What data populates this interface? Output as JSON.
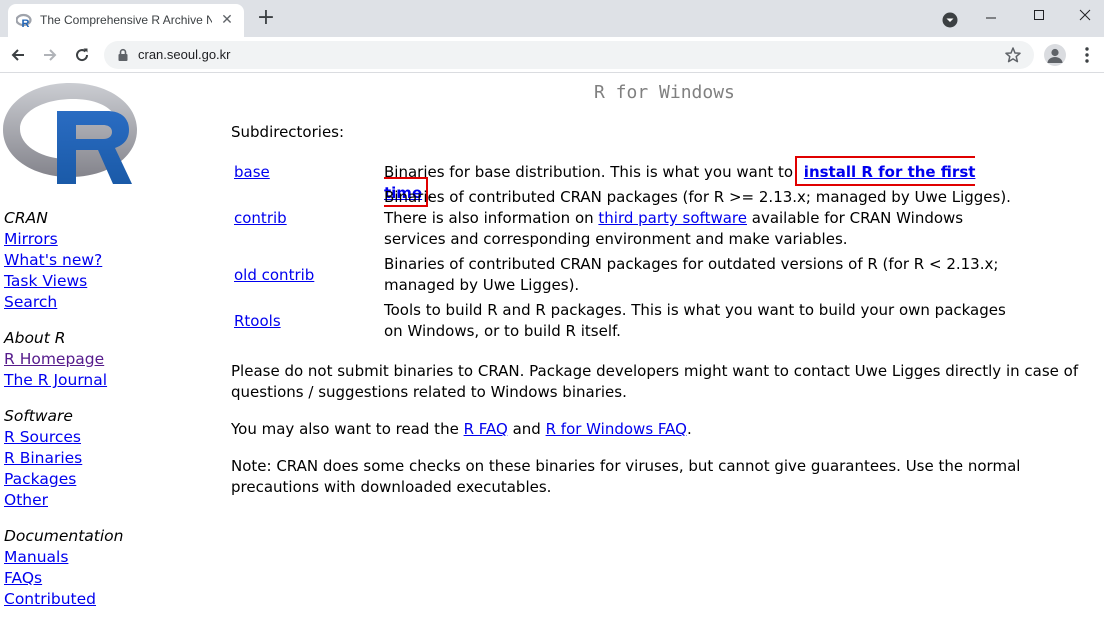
{
  "browser": {
    "tab_title": "The Comprehensive R Archive N",
    "url": "cran.seoul.go.kr",
    "close_glyph": "✕",
    "new_tab_glyph": "+"
  },
  "sidebar": {
    "groups": [
      {
        "heading": "CRAN",
        "links": [
          "Mirrors",
          "What's new?",
          "Task Views",
          "Search"
        ]
      },
      {
        "heading": "About R",
        "links": [
          "R Homepage",
          "The R Journal"
        ]
      },
      {
        "heading": "Software",
        "links": [
          "R Sources",
          "R Binaries",
          "Packages",
          "Other"
        ]
      },
      {
        "heading": "Documentation",
        "links": [
          "Manuals",
          "FAQs",
          "Contributed"
        ]
      }
    ]
  },
  "main": {
    "title": "R for Windows",
    "subdirectories_label": "Subdirectories:",
    "rows": [
      {
        "name": "base",
        "desc_before": "Binaries for base distribution. This is what you want to ",
        "desc_link": "install R for the first time",
        "desc_after": "."
      },
      {
        "name": "contrib",
        "line1": "Binaries of contributed CRAN packages (for R >= 2.13.x; managed by Uwe Ligges).",
        "line2_before": "There is also information on ",
        "line2_link": "third party software",
        "line2_after": " available for CRAN Windows services and corresponding environment and make variables."
      },
      {
        "name": "old contrib",
        "desc": "Binaries of contributed CRAN packages for outdated versions of R (for R < 2.13.x; managed by Uwe Ligges)."
      },
      {
        "name": "Rtools",
        "desc": "Tools to build R and R packages. This is what you want to build your own packages on Windows, or to build R itself."
      }
    ],
    "para1": "Please do not submit binaries to CRAN. Package developers might want to contact Uwe Ligges directly in case of questions / suggestions related to Windows binaries.",
    "para2_before": "You may also want to read the ",
    "para2_link1": "R FAQ",
    "para2_mid": " and ",
    "para2_link2": "R for Windows FAQ",
    "para2_after": ".",
    "para3": "Note: CRAN does some checks on these binaries for viruses, but cannot give guarantees. Use the normal precautions with downloaded executables."
  },
  "colors": {
    "link": "#0000ee",
    "visited_link": "#551a8b",
    "highlight_box": "#e00000",
    "title_gray": "#808080"
  }
}
